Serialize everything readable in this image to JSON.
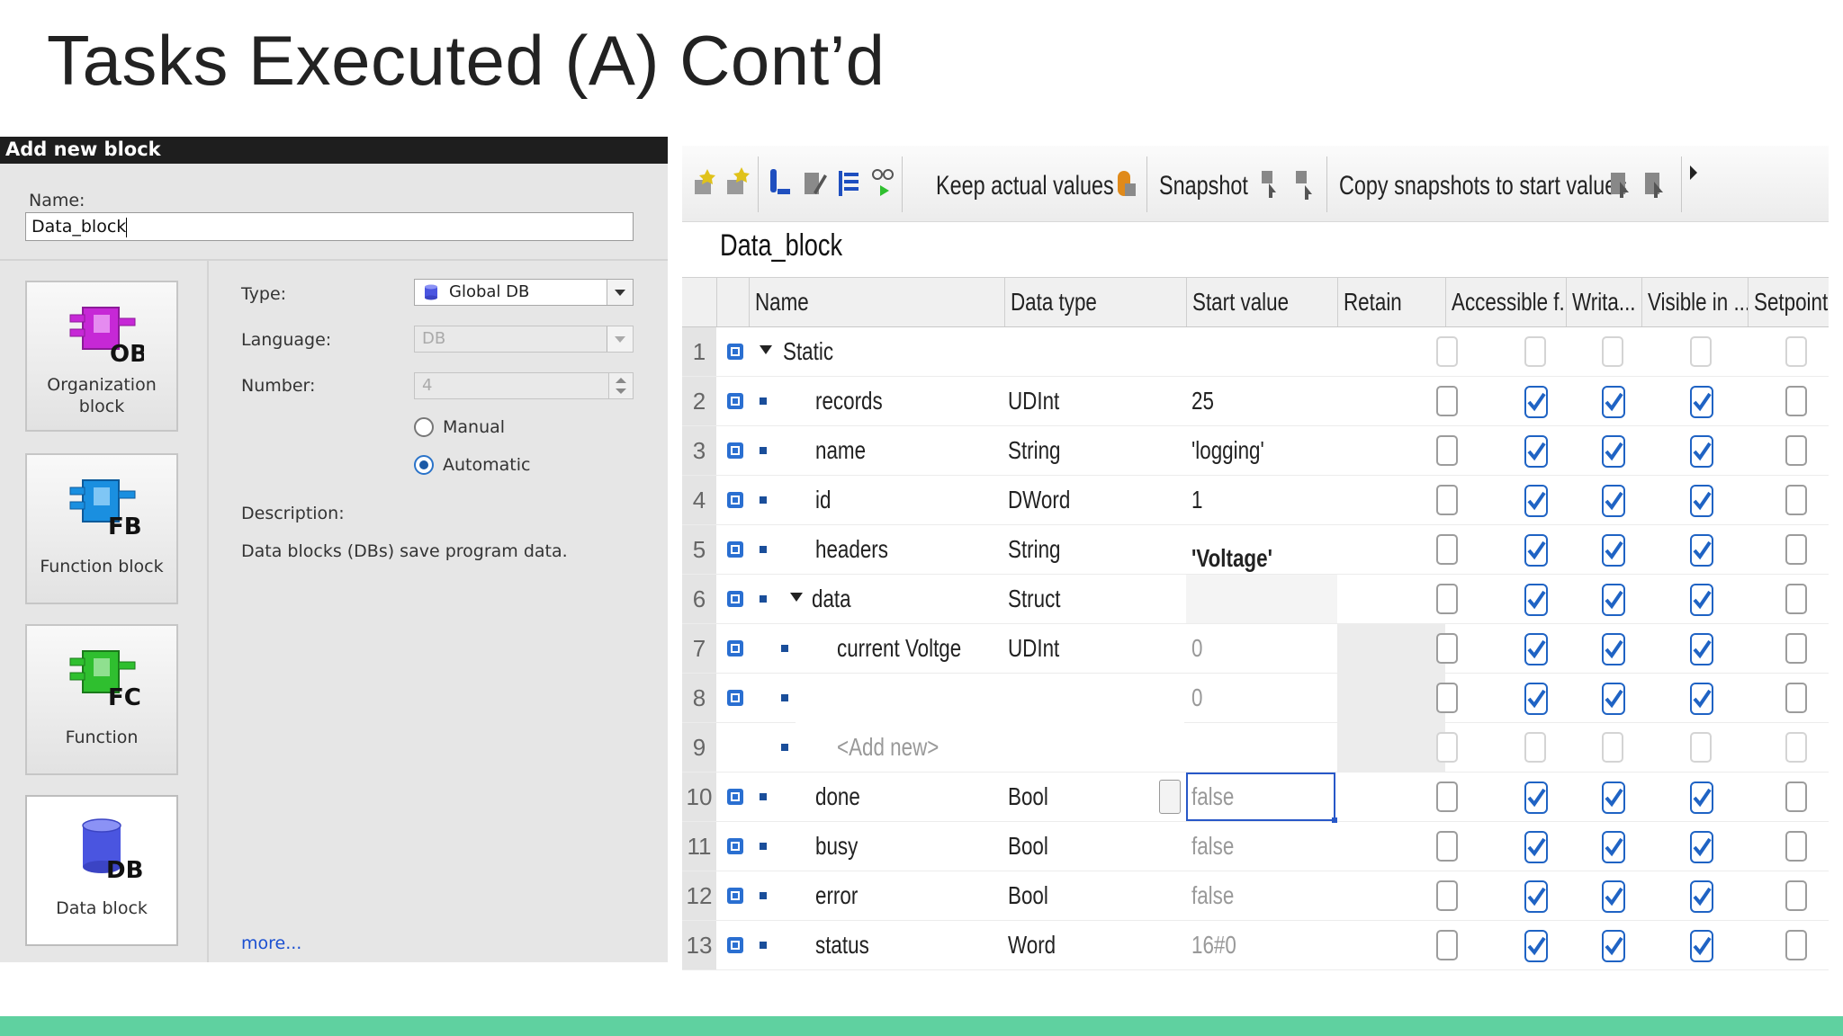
{
  "slide": {
    "title": "Tasks Executed (A) Cont’d"
  },
  "dialog": {
    "title": "Add new block",
    "name_label": "Name:",
    "name_value": "Data_block",
    "blocks": [
      {
        "icon": "organization-block-icon",
        "badge": "OB",
        "label_line1": "Organization",
        "label_line2": "block",
        "color": "#c628d6"
      },
      {
        "icon": "function-block-icon",
        "badge": "FB",
        "label_line1": "Function block",
        "label_line2": "",
        "color": "#1a8fe0"
      },
      {
        "icon": "function-icon",
        "badge": "FC",
        "label_line1": "Function",
        "label_line2": "",
        "color": "#2fbf2f"
      },
      {
        "icon": "data-block-icon",
        "badge": "DB",
        "label_line1": "Data block",
        "label_line2": "",
        "color": "#4a55e0",
        "selected": true
      }
    ],
    "type_label": "Type:",
    "type_value": "Global DB",
    "language_label": "Language:",
    "language_value": "DB",
    "number_label": "Number:",
    "number_value": "4",
    "radio_manual": "Manual",
    "radio_automatic": "Automatic",
    "radio_selected": "Automatic",
    "description_label": "Description:",
    "description_text": "Data blocks (DBs) save program data.",
    "more_link": "more..."
  },
  "editor": {
    "toolbar": {
      "keep_actual": "Keep actual values",
      "snapshot": "Snapshot",
      "copy_snapshots": "Copy snapshots to start values"
    },
    "block_name": "Data_block",
    "columns": [
      "Name",
      "Data type",
      "Start value",
      "Retain",
      "Accessible f...",
      "Writa...",
      "Visible in ...",
      "Setpoint"
    ],
    "rows": [
      {
        "num": "1",
        "name": "Static",
        "type": "",
        "start": "",
        "level": 0,
        "expander": true,
        "retain": false,
        "access": false,
        "write": false,
        "visible": false,
        "setpoint": false,
        "faint": true
      },
      {
        "num": "2",
        "name": "records",
        "type": "UDInt",
        "start": "25",
        "level": 1,
        "retain": false,
        "access": true,
        "write": true,
        "visible": true,
        "setpoint": false
      },
      {
        "num": "3",
        "name": "name",
        "type": "String",
        "start": "'logging'",
        "level": 1,
        "retain": false,
        "access": true,
        "write": true,
        "visible": true,
        "setpoint": false
      },
      {
        "num": "4",
        "name": "id",
        "type": "DWord",
        "start": "1",
        "level": 1,
        "retain": false,
        "access": true,
        "write": true,
        "visible": true,
        "setpoint": false
      },
      {
        "num": "5",
        "name": "headers",
        "type": "String",
        "start": "'Voltage'",
        "level": 1,
        "retain": false,
        "access": true,
        "write": true,
        "visible": true,
        "setpoint": false
      },
      {
        "num": "6",
        "name": "data",
        "type": "Struct",
        "start": "",
        "level": 1,
        "expander": true,
        "retain": false,
        "access": true,
        "write": true,
        "visible": true,
        "setpoint": false
      },
      {
        "num": "7",
        "name": "current  Voltge",
        "type": "UDInt",
        "start": "0",
        "level": 2,
        "grey_start": true,
        "retain": false,
        "access": true,
        "write": true,
        "visible": true,
        "setpoint": false
      },
      {
        "num": "8",
        "name": "",
        "type": "",
        "start": "0",
        "level": 2,
        "grey_start": true,
        "retain": false,
        "access": true,
        "write": true,
        "visible": true,
        "setpoint": false
      },
      {
        "num": "9",
        "name": "<Add new>",
        "type": "",
        "start": "",
        "level": 2,
        "add_new": true,
        "retain": false,
        "access": false,
        "write": false,
        "visible": false,
        "setpoint": false,
        "faint": true
      },
      {
        "num": "10",
        "name": "done",
        "type": "Bool",
        "start": "false",
        "level": 1,
        "grey_start": true,
        "editing": true,
        "retain": false,
        "access": true,
        "write": true,
        "visible": true,
        "setpoint": false
      },
      {
        "num": "11",
        "name": "busy",
        "type": "Bool",
        "start": "false",
        "level": 1,
        "grey_start": true,
        "retain": false,
        "access": true,
        "write": true,
        "visible": true,
        "setpoint": false
      },
      {
        "num": "12",
        "name": "error",
        "type": "Bool",
        "start": "false",
        "level": 1,
        "grey_start": true,
        "retain": false,
        "access": true,
        "write": true,
        "visible": true,
        "setpoint": false
      },
      {
        "num": "13",
        "name": "status",
        "type": "Word",
        "start": "16#0",
        "level": 1,
        "grey_start": true,
        "retain": false,
        "access": true,
        "write": true,
        "visible": true,
        "setpoint": false
      }
    ]
  },
  "colors": {
    "accent_bar": "#5fd1a0",
    "checkbox_blue": "#1f63c4"
  }
}
